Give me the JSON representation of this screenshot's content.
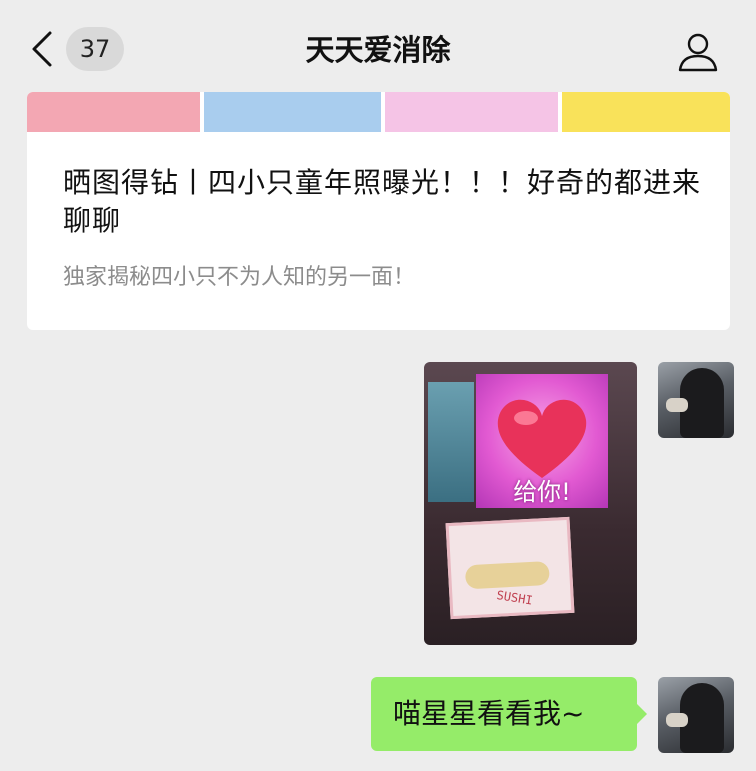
{
  "header": {
    "badge_count": "37",
    "title": "天天爱消除",
    "back_icon": "chevron-left-icon",
    "profile_icon": "person-icon"
  },
  "article_card": {
    "strip_colors": [
      "#f3a7b3",
      "#a9cdee",
      "#f5c4e6",
      "#f9e25a"
    ],
    "title": "晒图得钻丨四小只童年照曝光！！！好奇的都进来聊聊",
    "description": "独家揭秘四小只不为人知的另一面！"
  },
  "messages": {
    "photo": {
      "sticker_text": "给你!",
      "box_label": "SUSHI"
    },
    "text_message": "喵星星看看我~"
  },
  "colors": {
    "background": "#ededed",
    "bubble": "#95ec69"
  }
}
